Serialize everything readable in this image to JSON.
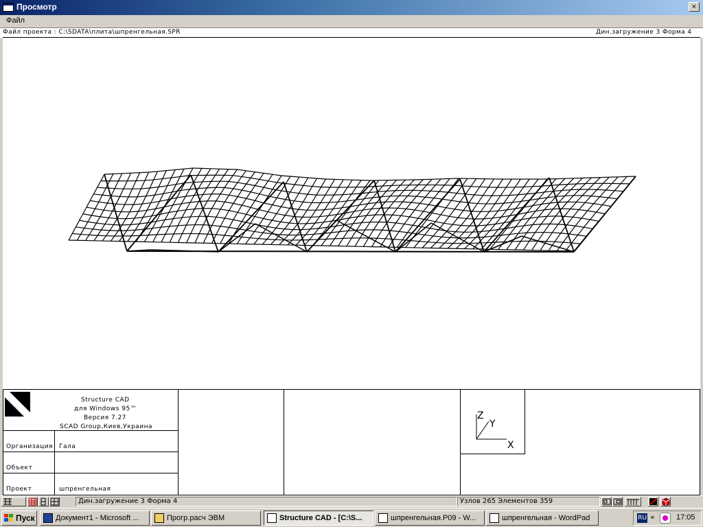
{
  "window": {
    "title": "Просмотр",
    "close_glyph": "×"
  },
  "menu": {
    "file": "Файл"
  },
  "info": {
    "project_path": "Файл проекта : C:\\SDATA\\плита\\шпренгельная.SPR",
    "load_case": "Дин.загружение 3  Форма 4"
  },
  "stamp": {
    "product": "Structure CAD",
    "platform": "для Windows 95™",
    "version": "Версия 7.27",
    "company": "SCAD Group,Киев,Украина",
    "org_label": "Организация",
    "org_value": "Гала",
    "object_label": "Объект",
    "object_value": "",
    "project_label": "Проект",
    "project_value": "шпренгельная",
    "axis_z": "Z",
    "axis_y": "Y",
    "axis_x": "X"
  },
  "status": {
    "load_case": "Дин.загружение 3  Форма 4",
    "counts": "Узлов 265 Элементов 359"
  },
  "taskbar": {
    "start": "Пуск",
    "tasks": [
      {
        "label": "Документ1 - Microsoft ...",
        "icon": "word-icon"
      },
      {
        "label": "Прогр.расч ЭВМ",
        "icon": "folder-icon"
      },
      {
        "label": "Structure CAD  - [C:\\S...",
        "icon": "scad-icon"
      },
      {
        "label": "шпренгельная.P09 - W...",
        "icon": "notepad-icon"
      },
      {
        "label": "шпренгельная - WordPad",
        "icon": "wordpad-icon"
      }
    ],
    "lang": "RU",
    "chevron": "«",
    "clock": "17:05"
  },
  "colors": {
    "titlebar_start": "#0a246a",
    "titlebar_end": "#a6caf0",
    "face": "#d4d0c8"
  }
}
